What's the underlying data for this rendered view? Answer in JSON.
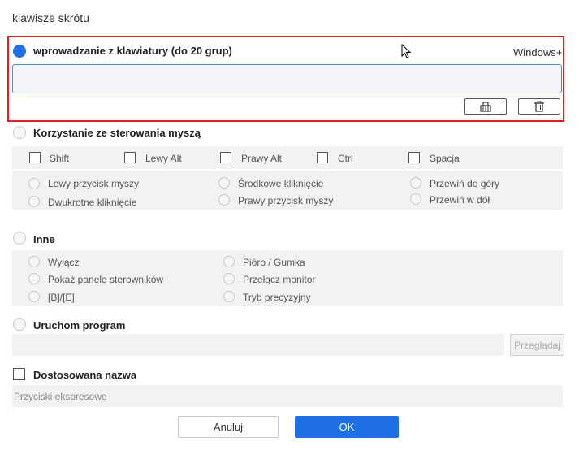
{
  "dialog": {
    "title": "klawisze skrótu"
  },
  "keyboard": {
    "label": "wprowadzanie z klawiatury (do 20 grup)",
    "modifier": "Windows+",
    "input_value": "",
    "icons": [
      "clear-icon",
      "trash-icon"
    ]
  },
  "mouse": {
    "label": "Korzystanie ze sterowania myszą",
    "modifiers": [
      "Shift",
      "Lewy Alt",
      "Prawy Alt",
      "Ctrl",
      "Spacja"
    ],
    "actions": [
      "Lewy przycisk myszy",
      "Dwukrotne kliknięcie",
      "Środkowe kliknięcie",
      "Prawy przycisk myszy",
      "Przewiń do góry",
      "Przewiń w dół"
    ]
  },
  "other": {
    "label": "Inne",
    "options": [
      "Wyłącz",
      "Pokaż panele sterowników",
      "[B]/[E]",
      "Pióro / Gumka",
      "Przełącz monitor",
      "Tryb precyzyjny"
    ]
  },
  "program": {
    "label": "Uruchom program",
    "path_value": "",
    "browse_label": "Przeglądaj"
  },
  "custom_name": {
    "label": "Dostosowana nazwa",
    "value": "Przyciski ekspresowe"
  },
  "footer": {
    "cancel_label": "Anuluj",
    "ok_label": "OK"
  },
  "colors": {
    "accent": "#1f6fe5",
    "highlight": "#e02020"
  }
}
